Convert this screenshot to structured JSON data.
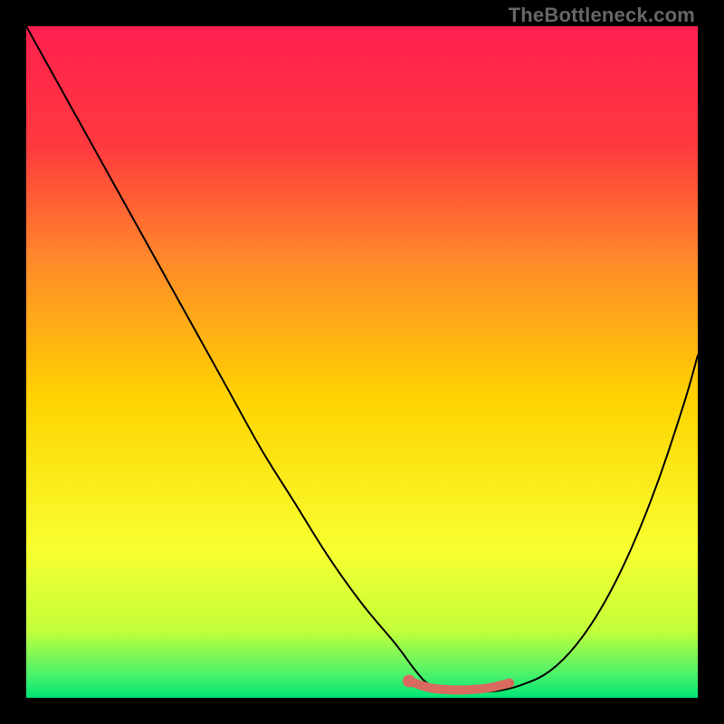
{
  "watermark": "TheBottleneck.com",
  "colors": {
    "bg_black": "#000000",
    "grad_top": "#ff1f4f",
    "grad_mid_top": "#ff6a3a",
    "grad_mid": "#ffd200",
    "grad_mid_low": "#f8ff30",
    "grad_low": "#9dff4a",
    "grad_bottom": "#00e676",
    "curve": "#000000",
    "marker": "#d86a5f"
  },
  "chart_data": {
    "type": "line",
    "title": "",
    "xlabel": "",
    "ylabel": "",
    "xlim": [
      0,
      100
    ],
    "ylim": [
      0,
      100
    ],
    "series": [
      {
        "name": "bottleneck-curve",
        "x": [
          0,
          5,
          10,
          15,
          20,
          25,
          30,
          35,
          40,
          45,
          50,
          55,
          58,
          60,
          63,
          66,
          70,
          74,
          78,
          82,
          86,
          90,
          94,
          98,
          100
        ],
        "y": [
          100,
          91,
          82,
          73,
          64,
          55,
          46,
          37,
          29,
          21,
          14,
          8,
          4,
          2,
          1,
          1,
          1,
          2,
          4,
          8,
          14,
          22,
          32,
          44,
          51
        ]
      },
      {
        "name": "highlight-segment",
        "x": [
          57,
          60,
          63,
          66,
          69,
          72
        ],
        "y": [
          2.5,
          1.5,
          1.2,
          1.2,
          1.5,
          2.2
        ]
      }
    ],
    "markers": [
      {
        "name": "highlight-dot-start",
        "x": 57,
        "y": 2.5
      }
    ],
    "gradient_stops": [
      {
        "pos": 0.0,
        "color": "#ff1f4f"
      },
      {
        "pos": 0.18,
        "color": "#ff3a3e"
      },
      {
        "pos": 0.35,
        "color": "#ff8a2a"
      },
      {
        "pos": 0.55,
        "color": "#ffd200"
      },
      {
        "pos": 0.78,
        "color": "#f8ff30"
      },
      {
        "pos": 0.9,
        "color": "#c3ff3a"
      },
      {
        "pos": 0.965,
        "color": "#4bf26a"
      },
      {
        "pos": 1.0,
        "color": "#00e676"
      }
    ]
  }
}
